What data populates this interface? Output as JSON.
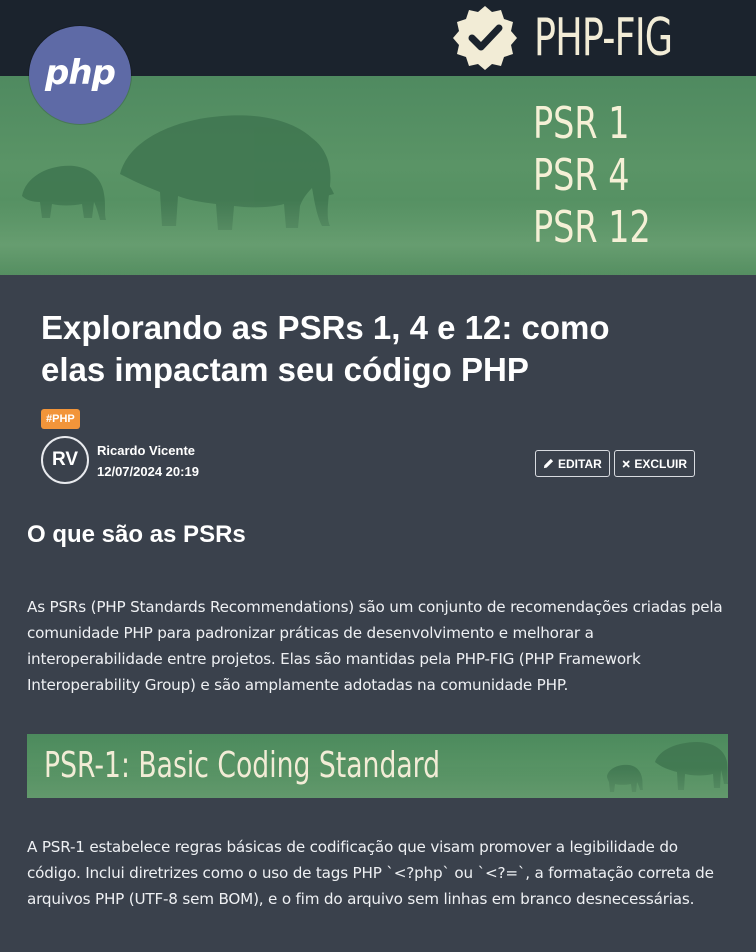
{
  "hero": {
    "logo_text": "php",
    "brand_text": "PHP-FIG",
    "psr_lines": [
      "PSR 1",
      "PSR 4",
      "PSR 12"
    ]
  },
  "post": {
    "title": "Explorando as PSRs 1, 4 e 12: como elas impactam seu código PHP",
    "tag": "#PHP",
    "author": {
      "initials": "RV",
      "name": "Ricardo Vicente",
      "date": "12/07/2024 20:19"
    },
    "actions": {
      "edit_label": "EDITAR",
      "delete_label": "EXCLUIR"
    }
  },
  "content": {
    "heading_1": "O que são as PSRs",
    "paragraph_1": "As PSRs (PHP Standards Recommendations) são um conjunto de recomendações criadas pela comunidade PHP para padronizar práticas de desenvolvimento e melhorar a interoperabilidade entre projetos. Elas são mantidas pela PHP-FIG (PHP Framework Interoperability Group) e são amplamente adotadas na comunidade PHP.",
    "section_banner_title": "PSR-1: Basic Coding Standard",
    "paragraph_2": "A PSR-1 estabelece regras básicas de codificação que visam promover a legibilidade do código. Inclui diretrizes como o uso de tags PHP `<?php` ou `<?=`, a formatação correta de arquivos PHP (UTF-8 sem BOM), e o fim do arquivo sem linhas em branco desnecessárias."
  },
  "icons": {
    "edit": "pencil-icon",
    "delete": "close-icon",
    "badge": "check-badge-icon"
  },
  "colors": {
    "background": "#3a414c",
    "banner_green": "#4f8a60",
    "tag_orange": "#f2953a",
    "php_logo": "#5e6aa6"
  }
}
